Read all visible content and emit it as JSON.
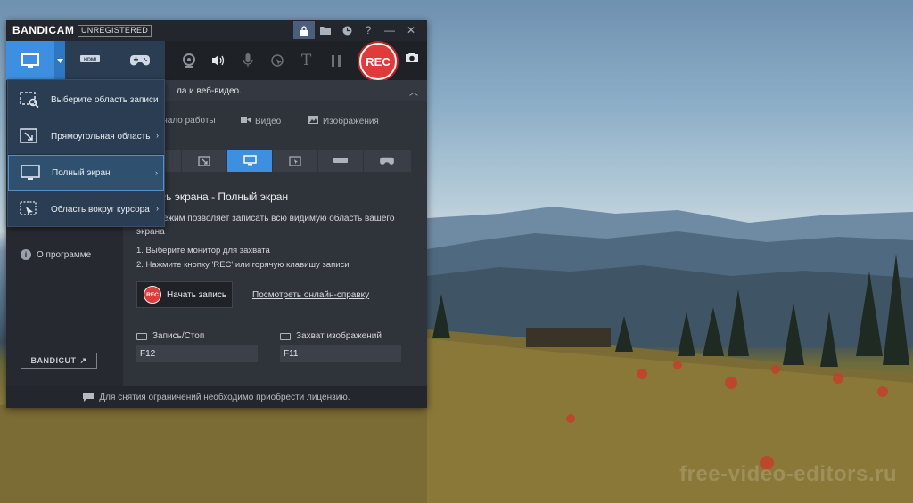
{
  "app": {
    "brand": "BANDICAM",
    "registration": "UNREGISTERED"
  },
  "titlebar": {
    "icons": [
      "lock-icon",
      "folder-icon",
      "clock-icon",
      "help-icon",
      "minimize-icon",
      "close-icon"
    ]
  },
  "toolbar": {
    "rec_label": "REC",
    "hdmi_label": "HDMI"
  },
  "dropdown": {
    "items": [
      {
        "label": "Выберите область записи"
      },
      {
        "label": "Прямоугольная область"
      },
      {
        "label": "Полный экран"
      },
      {
        "label": "Область вокруг курсора"
      }
    ]
  },
  "content": {
    "header": "ла и веб-видео.",
    "tabs": [
      "Начало работы",
      "Видео",
      "Изображения"
    ],
    "section_title": "Запись экрана - Полный экран",
    "description": "Этот режим позволяет записать всю видимую область вашего экрана",
    "steps": [
      "1. Выберите монитор для захвата",
      "2. Нажмите кнопку 'REC' или горячую клавишу записи"
    ],
    "start_button": "Начать запись",
    "start_button_icon": "REC",
    "help_link": "Посмотреть онлайн-справку",
    "hotkey_record_label": "Запись/Стоп",
    "hotkey_record_value": "F12",
    "hotkey_capture_label": "Захват изображений",
    "hotkey_capture_value": "F11"
  },
  "sidebar": {
    "about": "О программе",
    "bandicut": "BANDICUT"
  },
  "footer": {
    "text": "Для снятия ограничений необходимо приобрести лицензию."
  },
  "watermark": "free-video-editors.ru",
  "colors": {
    "accent": "#3e8fe0",
    "rec": "#e03a3a",
    "window_bg": "#2b2f36"
  }
}
